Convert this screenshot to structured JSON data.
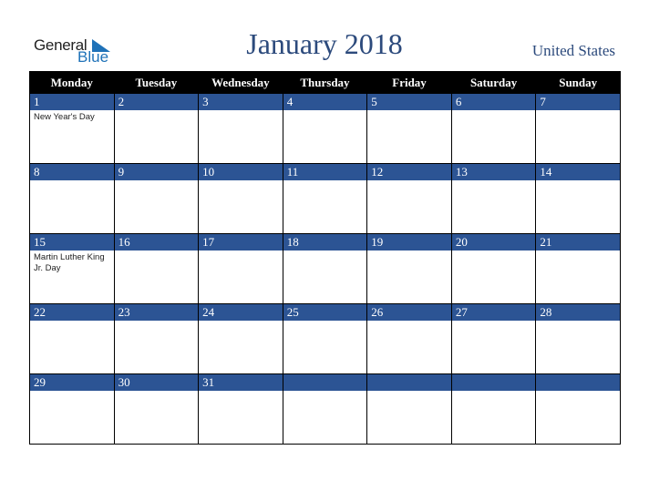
{
  "logo": {
    "general": "General",
    "blue": "Blue"
  },
  "title": "January 2018",
  "country": "United States",
  "colors": {
    "header_bg": "#000000",
    "date_strip": "#2c5494",
    "title": "#2c4a7c",
    "logo_blue": "#1f72b8"
  },
  "weekdays": [
    "Monday",
    "Tuesday",
    "Wednesday",
    "Thursday",
    "Friday",
    "Saturday",
    "Sunday"
  ],
  "weeks": [
    [
      {
        "d": "1",
        "ev": "New Year's Day"
      },
      {
        "d": "2",
        "ev": ""
      },
      {
        "d": "3",
        "ev": ""
      },
      {
        "d": "4",
        "ev": ""
      },
      {
        "d": "5",
        "ev": ""
      },
      {
        "d": "6",
        "ev": ""
      },
      {
        "d": "7",
        "ev": ""
      }
    ],
    [
      {
        "d": "8",
        "ev": ""
      },
      {
        "d": "9",
        "ev": ""
      },
      {
        "d": "10",
        "ev": ""
      },
      {
        "d": "11",
        "ev": ""
      },
      {
        "d": "12",
        "ev": ""
      },
      {
        "d": "13",
        "ev": ""
      },
      {
        "d": "14",
        "ev": ""
      }
    ],
    [
      {
        "d": "15",
        "ev": "Martin Luther King Jr. Day"
      },
      {
        "d": "16",
        "ev": ""
      },
      {
        "d": "17",
        "ev": ""
      },
      {
        "d": "18",
        "ev": ""
      },
      {
        "d": "19",
        "ev": ""
      },
      {
        "d": "20",
        "ev": ""
      },
      {
        "d": "21",
        "ev": ""
      }
    ],
    [
      {
        "d": "22",
        "ev": ""
      },
      {
        "d": "23",
        "ev": ""
      },
      {
        "d": "24",
        "ev": ""
      },
      {
        "d": "25",
        "ev": ""
      },
      {
        "d": "26",
        "ev": ""
      },
      {
        "d": "27",
        "ev": ""
      },
      {
        "d": "28",
        "ev": ""
      }
    ],
    [
      {
        "d": "29",
        "ev": ""
      },
      {
        "d": "30",
        "ev": ""
      },
      {
        "d": "31",
        "ev": ""
      },
      {
        "d": "",
        "ev": ""
      },
      {
        "d": "",
        "ev": ""
      },
      {
        "d": "",
        "ev": ""
      },
      {
        "d": "",
        "ev": ""
      }
    ]
  ]
}
